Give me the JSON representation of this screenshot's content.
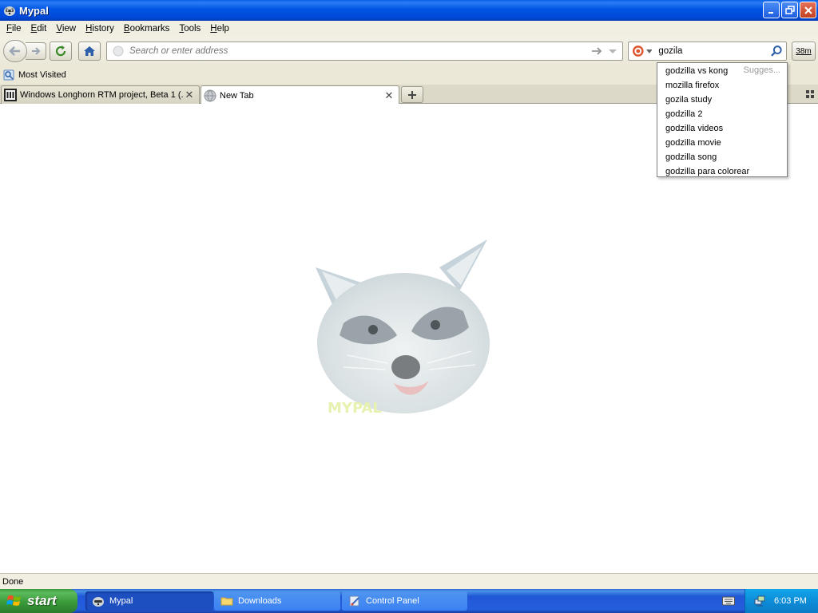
{
  "window": {
    "title": "Mypal"
  },
  "menu": [
    {
      "label": "File",
      "key": "F",
      "rest": "ile"
    },
    {
      "label": "Edit",
      "key": "E",
      "rest": "dit"
    },
    {
      "label": "View",
      "key": "V",
      "rest": "iew"
    },
    {
      "label": "History",
      "key": "H",
      "rest": "istory"
    },
    {
      "label": "Bookmarks",
      "key": "B",
      "rest": "ookmarks"
    },
    {
      "label": "Tools",
      "key": "T",
      "rest": "ools"
    },
    {
      "label": "Help",
      "key": "H",
      "rest": "elp"
    }
  ],
  "toolbar": {
    "url_placeholder": "Search or enter address",
    "search_value": "gozila",
    "clock_label": "38m"
  },
  "bookmarks": {
    "most_visited": "Most Visited"
  },
  "tabs": [
    {
      "label": "Windows Longhorn RTM project, Beta 1 (...",
      "active": false
    },
    {
      "label": "New Tab",
      "active": true
    }
  ],
  "suggestions": {
    "hint": "Sugges...",
    "items": [
      "godzilla vs kong",
      "mozilla firefox",
      "gozila study",
      "godzilla 2",
      "godzilla videos",
      "godzilla movie",
      "godzilla song",
      "godzilla para colorear"
    ]
  },
  "content": {
    "logo_text": "MYPAL"
  },
  "status": {
    "text": "Done"
  },
  "taskbar": {
    "start_label": "start",
    "tasks": [
      {
        "label": "Mypal",
        "icon": "raccoon-icon",
        "active": true
      },
      {
        "label": "Downloads",
        "icon": "folder-icon",
        "active": false
      },
      {
        "label": "Control Panel",
        "icon": "control-panel-icon",
        "active": false
      }
    ],
    "clock": "6:03 PM"
  },
  "colors": {
    "titlebar": "#0054e3",
    "taskbar": "#245edc",
    "start": "#3a9a3a",
    "tray": "#0d8dd8"
  }
}
